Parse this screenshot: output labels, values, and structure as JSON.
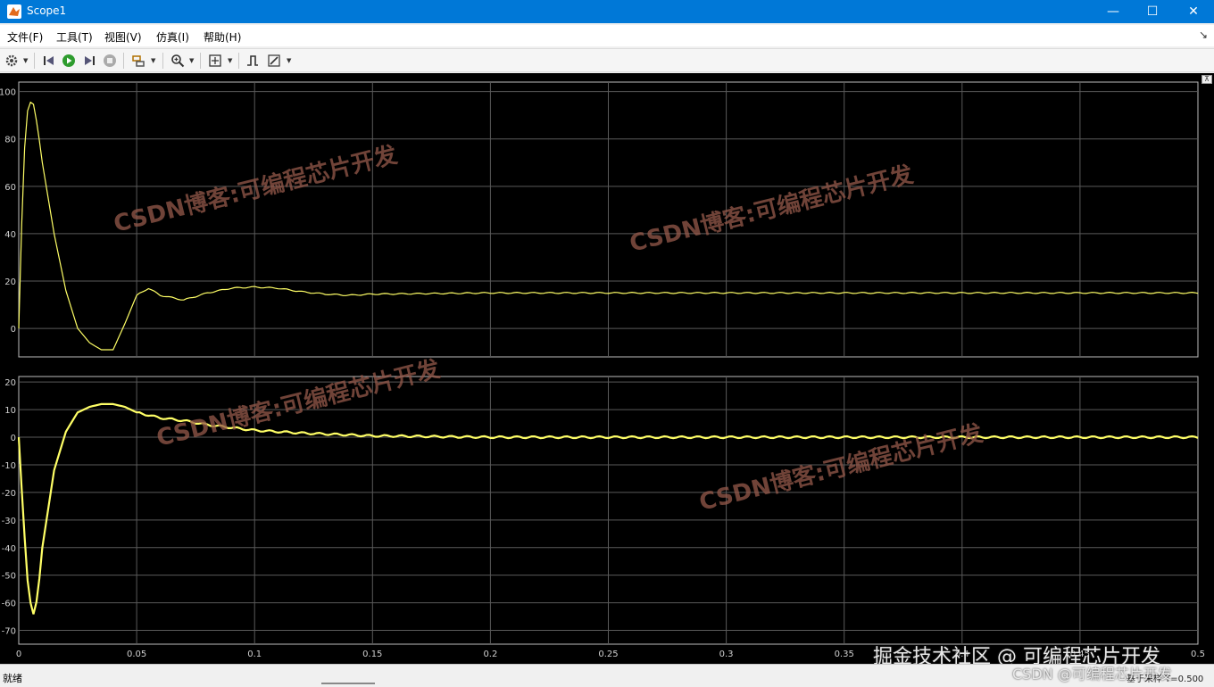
{
  "window": {
    "title": "Scope1",
    "minimize": "—",
    "maximize": "☐",
    "close": "✕"
  },
  "menu": [
    "文件(F)",
    "工具(T)",
    "视图(V)",
    "仿真(I)",
    "帮助(H)"
  ],
  "menu_dock_icon": "dock-arrow-icon",
  "toolbar": [
    "settings-icon",
    "step-back-icon",
    "run-icon",
    "step-forward-icon",
    "stop-icon",
    "highlight-block-icon",
    "zoom-icon",
    "fit-axes-icon",
    "trigger-icon",
    "style-icon"
  ],
  "chart_data": [
    {
      "type": "line",
      "series_color": "#ffff66",
      "ylim": [
        -12,
        104
      ],
      "yticks": [
        "100",
        "80",
        "60",
        "40",
        "20",
        "0"
      ],
      "xlim": [
        0,
        0.5
      ],
      "x": [
        0,
        0.002,
        0.004,
        0.006,
        0.008,
        0.01,
        0.015,
        0.02,
        0.025,
        0.03,
        0.035,
        0.04,
        0.045,
        0.05,
        0.055,
        0.06,
        0.07,
        0.08,
        0.09,
        0.1,
        0.11,
        0.12,
        0.13,
        0.14,
        0.15,
        0.2,
        0.25,
        0.3,
        0.35,
        0.4,
        0.45,
        0.5
      ],
      "y": [
        0,
        70,
        95,
        96,
        85,
        70,
        40,
        16,
        0,
        -6,
        -9,
        -9,
        2,
        14,
        17,
        14,
        12,
        15,
        17,
        17.5,
        17,
        15.5,
        14.5,
        14,
        14.5,
        15,
        15,
        15,
        15,
        15,
        15,
        15
      ]
    },
    {
      "type": "line",
      "series_color": "#ffff66",
      "ylim": [
        -75,
        22
      ],
      "yticks": [
        "20",
        "10",
        "0",
        "-10",
        "-20",
        "-30",
        "-40",
        "-50",
        "-60",
        "-70"
      ],
      "xlim": [
        0,
        0.5
      ],
      "xticks": [
        "0",
        "0.05",
        "0.1",
        "0.15",
        "0.2",
        "0.25",
        "0.3",
        "0.35",
        "0.4",
        "0.45",
        "0.5"
      ],
      "x": [
        0,
        0.002,
        0.004,
        0.006,
        0.008,
        0.01,
        0.015,
        0.02,
        0.025,
        0.03,
        0.035,
        0.04,
        0.045,
        0.05,
        0.06,
        0.07,
        0.08,
        0.1,
        0.12,
        0.15,
        0.2,
        0.25,
        0.3,
        0.35,
        0.4,
        0.45,
        0.5
      ],
      "y": [
        0,
        -30,
        -55,
        -65,
        -58,
        -40,
        -12,
        2,
        9,
        11,
        12,
        12,
        11,
        9,
        7,
        6,
        4.5,
        2.5,
        1.5,
        0.5,
        0,
        0,
        0,
        0,
        0,
        0,
        0
      ]
    }
  ],
  "watermark_text": "CSDN博客:可编程芯片开发",
  "footer_watermark_1": "掘金技术社区 @ 可编程芯片开发",
  "footer_watermark_2": "CSDN @可编程芯片开发",
  "status": {
    "left": "就绪",
    "right": "基于采样 T=0.500"
  }
}
